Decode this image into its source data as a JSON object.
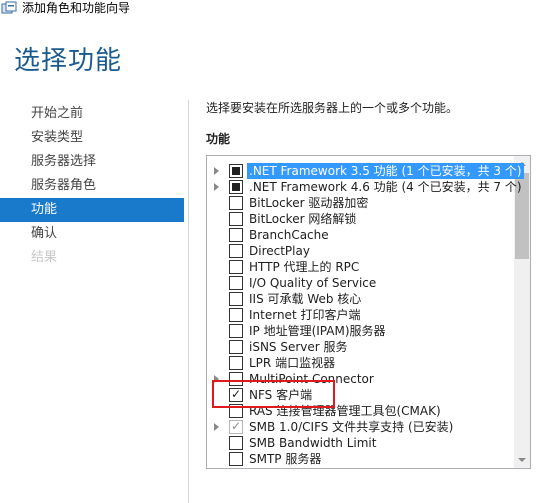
{
  "window": {
    "title": "添加角色和功能向导"
  },
  "page_title": "选择功能",
  "nav": {
    "items": [
      {
        "label": "开始之前",
        "state": "normal"
      },
      {
        "label": "安装类型",
        "state": "normal"
      },
      {
        "label": "服务器选择",
        "state": "normal"
      },
      {
        "label": "服务器角色",
        "state": "normal"
      },
      {
        "label": "功能",
        "state": "active"
      },
      {
        "label": "确认",
        "state": "normal"
      },
      {
        "label": "结果",
        "state": "disabled"
      }
    ]
  },
  "main": {
    "description": "选择要安装在所选服务器上的一个或多个功能。",
    "features_label": "功能",
    "features": [
      {
        "label": ".NET Framework 3.5 功能 (1 个已安装，共 3 个)",
        "check": "indeterminate",
        "expandable": true,
        "selected": true
      },
      {
        "label": ".NET Framework 4.6 功能 (4 个已安装，共 7 个)",
        "check": "indeterminate",
        "expandable": true,
        "selected": false
      },
      {
        "label": "BitLocker 驱动器加密",
        "check": "unchecked",
        "expandable": false,
        "selected": false
      },
      {
        "label": "BitLocker 网络解锁",
        "check": "unchecked",
        "expandable": false,
        "selected": false
      },
      {
        "label": "BranchCache",
        "check": "unchecked",
        "expandable": false,
        "selected": false
      },
      {
        "label": "DirectPlay",
        "check": "unchecked",
        "expandable": false,
        "selected": false
      },
      {
        "label": "HTTP 代理上的 RPC",
        "check": "unchecked",
        "expandable": false,
        "selected": false
      },
      {
        "label": "I/O Quality of Service",
        "check": "unchecked",
        "expandable": false,
        "selected": false
      },
      {
        "label": "IIS 可承载 Web 核心",
        "check": "unchecked",
        "expandable": false,
        "selected": false
      },
      {
        "label": "Internet 打印客户端",
        "check": "unchecked",
        "expandable": false,
        "selected": false
      },
      {
        "label": "IP 地址管理(IPAM)服务器",
        "check": "unchecked",
        "expandable": false,
        "selected": false
      },
      {
        "label": "iSNS Server 服务",
        "check": "unchecked",
        "expandable": false,
        "selected": false
      },
      {
        "label": "LPR 端口监视器",
        "check": "unchecked",
        "expandable": false,
        "selected": false
      },
      {
        "label": "MultiPoint Connector",
        "check": "unchecked",
        "expandable": true,
        "selected": false
      },
      {
        "label": "NFS 客户端",
        "check": "checked",
        "expandable": false,
        "selected": false
      },
      {
        "label": "RAS 连接管理器管理工具包(CMAK)",
        "check": "unchecked",
        "expandable": false,
        "selected": false
      },
      {
        "label": "SMB 1.0/CIFS 文件共享支持 (已安装)",
        "check": "checked-disabled",
        "expandable": true,
        "selected": false
      },
      {
        "label": "SMB Bandwidth Limit",
        "check": "unchecked",
        "expandable": false,
        "selected": false
      },
      {
        "label": "SMTP 服务器",
        "check": "unchecked",
        "expandable": false,
        "selected": false
      }
    ]
  },
  "colors": {
    "accent": "#1979ca",
    "title_blue": "#1a5a8f",
    "selection": "#3399ff",
    "highlight_box": "#e0191b"
  },
  "icons": {
    "app": "server-manager-icon",
    "check": "✓"
  }
}
